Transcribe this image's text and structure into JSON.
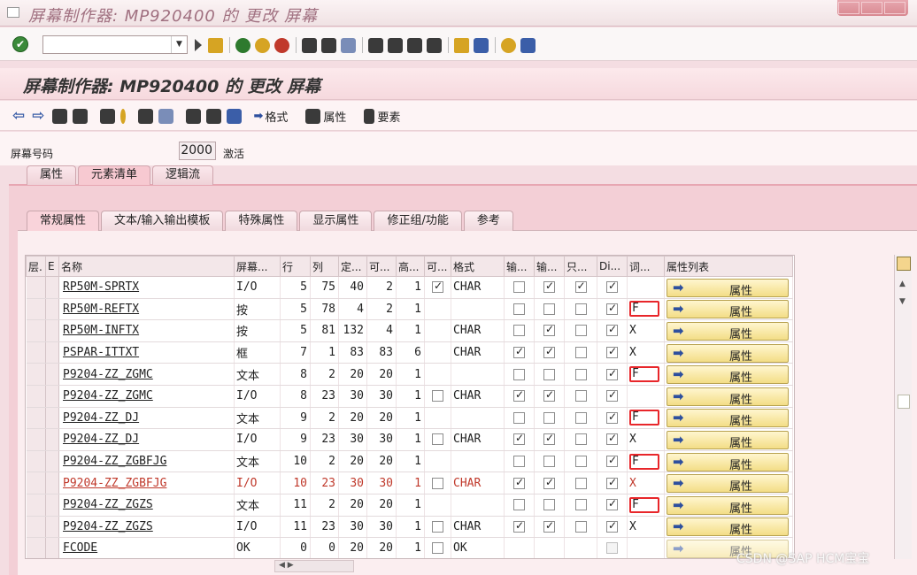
{
  "window": {
    "title": "屏幕制作器: MP920400 的 更改 屏幕"
  },
  "screen": {
    "title": "屏幕制作器: MP920400 的 更改 屏幕"
  },
  "app_toolbar": {
    "format_label": "格式",
    "attributes_label": "属性",
    "elements_label": "要素"
  },
  "screen_number": {
    "label": "屏幕号码",
    "value": "2000",
    "status": "激活"
  },
  "outer_tabs": [
    "属性",
    "元素清单",
    "逻辑流"
  ],
  "inner_tabs": [
    "常规属性",
    "文本/输入输出模板",
    "特殊属性",
    "显示属性",
    "修正组/功能",
    "参考"
  ],
  "table": {
    "headers": [
      "层.",
      "E",
      "名称",
      "屏幕...",
      "行",
      "列",
      "定...",
      "可...",
      "高...",
      "可...",
      "格式",
      "输...",
      "输...",
      "只...",
      "Di...",
      "词...",
      "属性列表"
    ],
    "prop_label": "属性",
    "rows": [
      {
        "name": "RP50M-SPRTX",
        "type": "I/O",
        "row": "5",
        "col": "75",
        "def": "40",
        "vis": "2",
        "h": "1",
        "c1": "on",
        "fmt": "CHAR",
        "i1": "off",
        "i2": "on",
        "ro": "on",
        "di": "on",
        "dict": "",
        "box": false,
        "red": false,
        "dim": false
      },
      {
        "name": "RP50M-REFTX",
        "type": "按",
        "row": "5",
        "col": "78",
        "def": "4",
        "vis": "2",
        "h": "1",
        "c1": "",
        "fmt": "",
        "i1": "off",
        "i2": "off",
        "ro": "off",
        "di": "on",
        "dict": "F",
        "box": true,
        "red": false,
        "dim": false
      },
      {
        "name": "RP50M-INFTX",
        "type": "按",
        "row": "5",
        "col": "81",
        "def": "132",
        "vis": "4",
        "h": "1",
        "c1": "",
        "fmt": "CHAR",
        "i1": "off",
        "i2": "on",
        "ro": "off",
        "di": "on",
        "dict": "X",
        "box": false,
        "red": false,
        "dim": false
      },
      {
        "name": "PSPAR-ITTXT",
        "type": "框",
        "row": "7",
        "col": "1",
        "def": "83",
        "vis": "83",
        "h": "6",
        "c1": "",
        "fmt": "CHAR",
        "i1": "on",
        "i2": "on",
        "ro": "off",
        "di": "on",
        "dict": "X",
        "box": false,
        "red": false,
        "dim": false
      },
      {
        "name": "P9204-ZZ_ZGMC",
        "type": "文本",
        "row": "8",
        "col": "2",
        "def": "20",
        "vis": "20",
        "h": "1",
        "c1": "",
        "fmt": "",
        "i1": "off",
        "i2": "off",
        "ro": "off",
        "di": "on",
        "dict": "F",
        "box": true,
        "red": false,
        "dim": false
      },
      {
        "name": "P9204-ZZ_ZGMC",
        "type": "I/O",
        "row": "8",
        "col": "23",
        "def": "30",
        "vis": "30",
        "h": "1",
        "c1": "off",
        "fmt": "CHAR",
        "i1": "on",
        "i2": "on",
        "ro": "off",
        "di": "on",
        "dict": "",
        "box": false,
        "red": false,
        "dim": false
      },
      {
        "name": "P9204-ZZ_DJ",
        "type": "文本",
        "row": "9",
        "col": "2",
        "def": "20",
        "vis": "20",
        "h": "1",
        "c1": "",
        "fmt": "",
        "i1": "off",
        "i2": "off",
        "ro": "off",
        "di": "on",
        "dict": "F",
        "box": true,
        "red": false,
        "dim": false
      },
      {
        "name": "P9204-ZZ_DJ",
        "type": "I/O",
        "row": "9",
        "col": "23",
        "def": "30",
        "vis": "30",
        "h": "1",
        "c1": "off",
        "fmt": "CHAR",
        "i1": "on",
        "i2": "on",
        "ro": "off",
        "di": "on",
        "dict": "X",
        "box": false,
        "red": false,
        "dim": false
      },
      {
        "name": "P9204-ZZ_ZGBFJG",
        "type": "文本",
        "row": "10",
        "col": "2",
        "def": "20",
        "vis": "20",
        "h": "1",
        "c1": "",
        "fmt": "",
        "i1": "off",
        "i2": "off",
        "ro": "off",
        "di": "on",
        "dict": "F",
        "box": true,
        "red": false,
        "dim": false
      },
      {
        "name": "P9204-ZZ_ZGBFJG",
        "type": "I/O",
        "row": "10",
        "col": "23",
        "def": "30",
        "vis": "30",
        "h": "1",
        "c1": "off",
        "fmt": "CHAR",
        "i1": "on",
        "i2": "on",
        "ro": "off",
        "di": "on",
        "dict": "X",
        "box": false,
        "red": true,
        "dim": false
      },
      {
        "name": "P9204-ZZ_ZGZS",
        "type": "文本",
        "row": "11",
        "col": "2",
        "def": "20",
        "vis": "20",
        "h": "1",
        "c1": "",
        "fmt": "",
        "i1": "off",
        "i2": "off",
        "ro": "off",
        "di": "on",
        "dict": "F",
        "box": true,
        "red": false,
        "dim": false
      },
      {
        "name": "P9204-ZZ_ZGZS",
        "type": "I/O",
        "row": "11",
        "col": "23",
        "def": "30",
        "vis": "30",
        "h": "1",
        "c1": "off",
        "fmt": "CHAR",
        "i1": "on",
        "i2": "on",
        "ro": "off",
        "di": "on",
        "dict": "X",
        "box": false,
        "red": false,
        "dim": false
      },
      {
        "name": "FCODE",
        "type": "OK",
        "row": "0",
        "col": "0",
        "def": "20",
        "vis": "20",
        "h": "1",
        "c1": "off",
        "fmt": "OK",
        "i1": "",
        "i2": "",
        "ro": "",
        "di": "gray",
        "dict": "",
        "box": false,
        "red": false,
        "dim": true
      }
    ]
  },
  "watermark": "CSDN @SAP HCM宝宝"
}
